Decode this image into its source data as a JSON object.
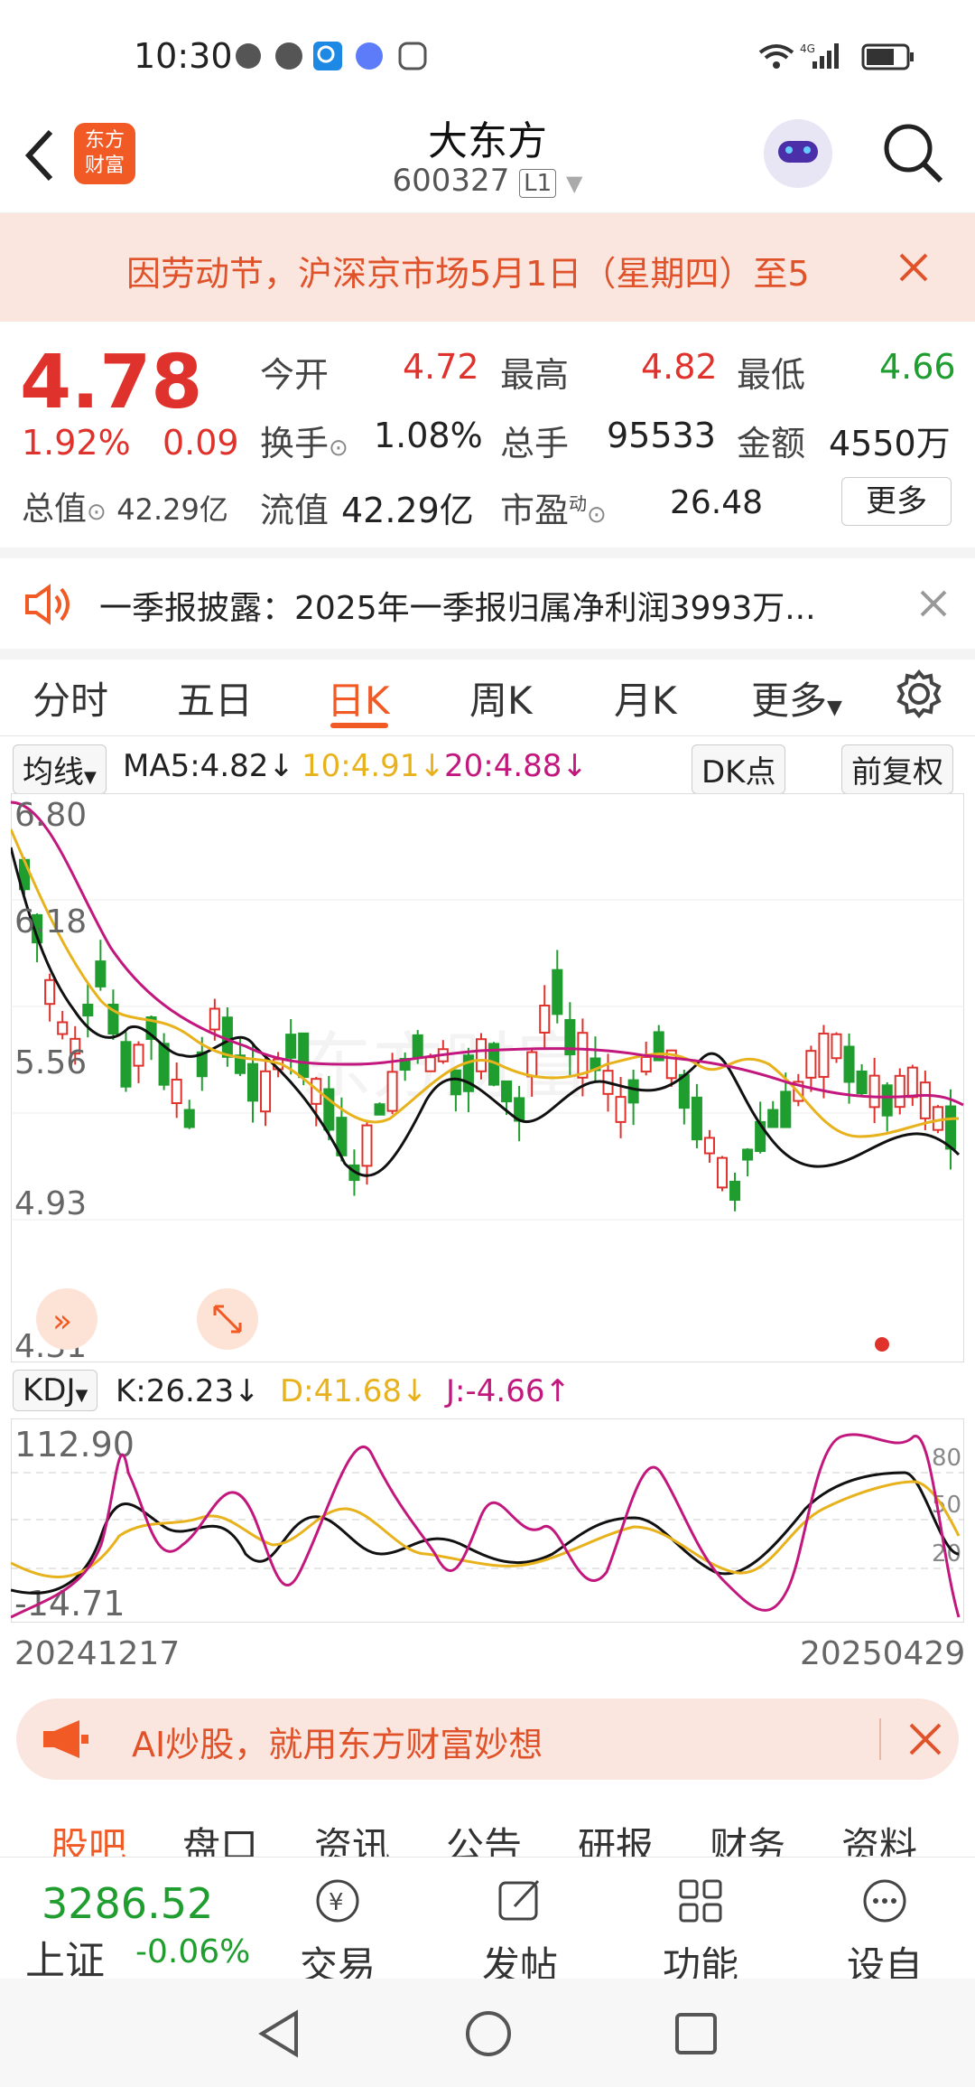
{
  "status": {
    "time": "10:30"
  },
  "header": {
    "title": "大东方",
    "code": "600327",
    "level": "L1",
    "logo_line1": "东方",
    "logo_line2": "财富"
  },
  "notice": {
    "text": "因劳动节，沪深京市场5月1日（星期四）至5"
  },
  "quote": {
    "price": "4.78",
    "change_pct": "1.92%",
    "change": "0.09",
    "open_label": "今开",
    "open": "4.72",
    "high_label": "最高",
    "high": "4.82",
    "low_label": "最低",
    "low": "4.66",
    "turnover_label": "换手",
    "turnover": "1.08%",
    "volume_label": "总手",
    "volume": "95533",
    "amount_label": "金额",
    "amount": "4550万",
    "mktcap_label": "总值",
    "mktcap": "42.29亿",
    "float_label": "流值",
    "float": "42.29亿",
    "pe_label": "市盈",
    "pe_sup": "动",
    "pe": "26.48",
    "more_button": "更多"
  },
  "news": {
    "text": "一季报披露：2025年一季报归属净利润3993万..."
  },
  "tabs": [
    "分时",
    "五日",
    "日K",
    "周K",
    "月K",
    "更多"
  ],
  "active_tab": "日K",
  "ma": {
    "selector": "均线",
    "ma5": "MA5:4.82↓",
    "ma10": "10:4.91↓",
    "ma20": "20:4.88↓",
    "dk_button": "DK点",
    "adjust_button": "前复权"
  },
  "kdj": {
    "selector": "KDJ",
    "k": "K:26.23↓",
    "d": "D:41.68↓",
    "j": "J:-4.66↑"
  },
  "chart_data": [
    {
      "type": "candlestick",
      "y_ticks": [
        "6.80",
        "6.18",
        "5.56",
        "4.93",
        "4.31"
      ],
      "ylim": [
        4.31,
        6.8
      ],
      "watermark": "东方财富"
    },
    {
      "type": "line",
      "y_ticks": [
        "112.90",
        "-14.71"
      ],
      "right_ticks": [
        "80",
        "50",
        "20"
      ],
      "x_start": "20241217",
      "x_end": "20250429",
      "series": [
        {
          "name": "K"
        },
        {
          "name": "D"
        },
        {
          "name": "J"
        }
      ]
    }
  ],
  "ai_banner": {
    "text": "AI炒股，就用东方财富妙想"
  },
  "bottom_tabs": [
    "股吧",
    "盘口",
    "资讯",
    "公告",
    "研报",
    "财务",
    "资料"
  ],
  "index": {
    "value": "3286.52",
    "name": "上证",
    "change": "-0.06%"
  },
  "nav": [
    "交易",
    "发帖",
    "功能",
    "设自选"
  ],
  "colors": {
    "up": "#e0322c",
    "down": "#1f9d2f",
    "accent": "#f15a24",
    "ma10": "#e8b21c",
    "ma20": "#c2187e"
  }
}
